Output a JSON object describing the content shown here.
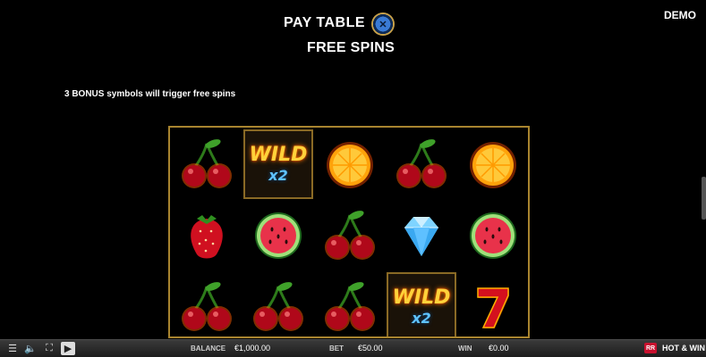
{
  "header": {
    "title": "PAY TABLE",
    "subtitle": "FREE SPINS",
    "demo_label": "DEMO",
    "close_icon": "close-icon"
  },
  "content": {
    "description": "3 BONUS symbols will trigger free spins"
  },
  "reels": {
    "rows": [
      [
        "cherry",
        "wild",
        "orange",
        "cherry",
        "orange"
      ],
      [
        "strawberry",
        "watermelon",
        "cherry",
        "diamond",
        "watermelon"
      ],
      [
        "cherry",
        "cherry",
        "cherry",
        "wild",
        "seven"
      ]
    ],
    "wild_text": "WILD",
    "wild_multiplier": "x2",
    "frame_color": "#a8842f"
  },
  "footer": {
    "balance_label": "BALANCE",
    "balance_value": "€1,000.00",
    "bet_label": "BET",
    "bet_value": "€50.00",
    "win_label": "WIN",
    "win_value": "€0.00",
    "brand_logo": "RR",
    "game_name": "HOT & WIN"
  }
}
